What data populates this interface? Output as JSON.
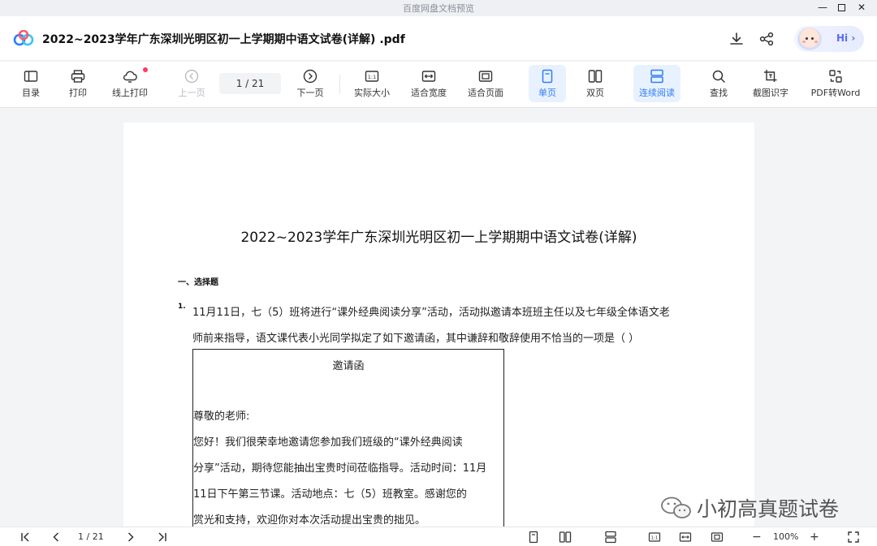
{
  "window": {
    "title": "百度网盘文档预览",
    "minimize_glyph": "—",
    "close_glyph": "✕"
  },
  "header": {
    "filename": "2022~2023学年广东深圳光明区初一上学期期中语文试卷(详解) .pdf",
    "hi_label": "Hi ›",
    "logo_icon": "baidu-netdisk-cloud-icon"
  },
  "toolbar": {
    "toc": "目录",
    "print": "打印",
    "online_print": "线上打印",
    "prev_page": "上一页",
    "page_indicator": "1 / 21",
    "next_page": "下一页",
    "actual_size": "实际大小",
    "fit_width": "适合宽度",
    "fit_page": "适合页面",
    "single_page": "单页",
    "double_page": "双页",
    "continuous": "连续阅读",
    "find": "查找",
    "ocr": "截图识字",
    "pdf_to_word": "PDF转Word"
  },
  "document": {
    "title": "2022~2023学年广东深圳光明区初一上学期期中语文试卷(详解)",
    "section": "一、选择题",
    "question_number": "1.",
    "question_line1": "11月11日，七（5）班将进行“课外经典阅读分享”活动，活动拟邀请本班班主任以及七年级全体语文老",
    "question_line2": "师前来指导，语文课代表小光同学拟定了如下邀请函，其中谦辞和敬辞使用不恰当的一项是（    ）",
    "invitation": {
      "title": "邀请函",
      "greeting": "尊敬的老师:",
      "line1": "    您好！我们很荣幸地邀请您参加我们班级的“课外经典阅读",
      "line2": "分享”活动，期待您能抽出宝贵时间莅临指导。活动时间：11月",
      "line3": "11日下午第三节课。活动地点：七（5）班教室。感谢您的",
      "line4": "赏光和支持，欢迎你对本次活动提出宝贵的拙见。"
    }
  },
  "watermark": {
    "text": "小初高真题试卷"
  },
  "statusbar": {
    "page_indicator": "1 / 21",
    "zoom": "100%",
    "zoom_out": "−",
    "zoom_in": "+"
  },
  "colors": {
    "accent": "#2f7cf6",
    "active_bg": "#e8f2ff",
    "badge": "#ff3b5c"
  }
}
